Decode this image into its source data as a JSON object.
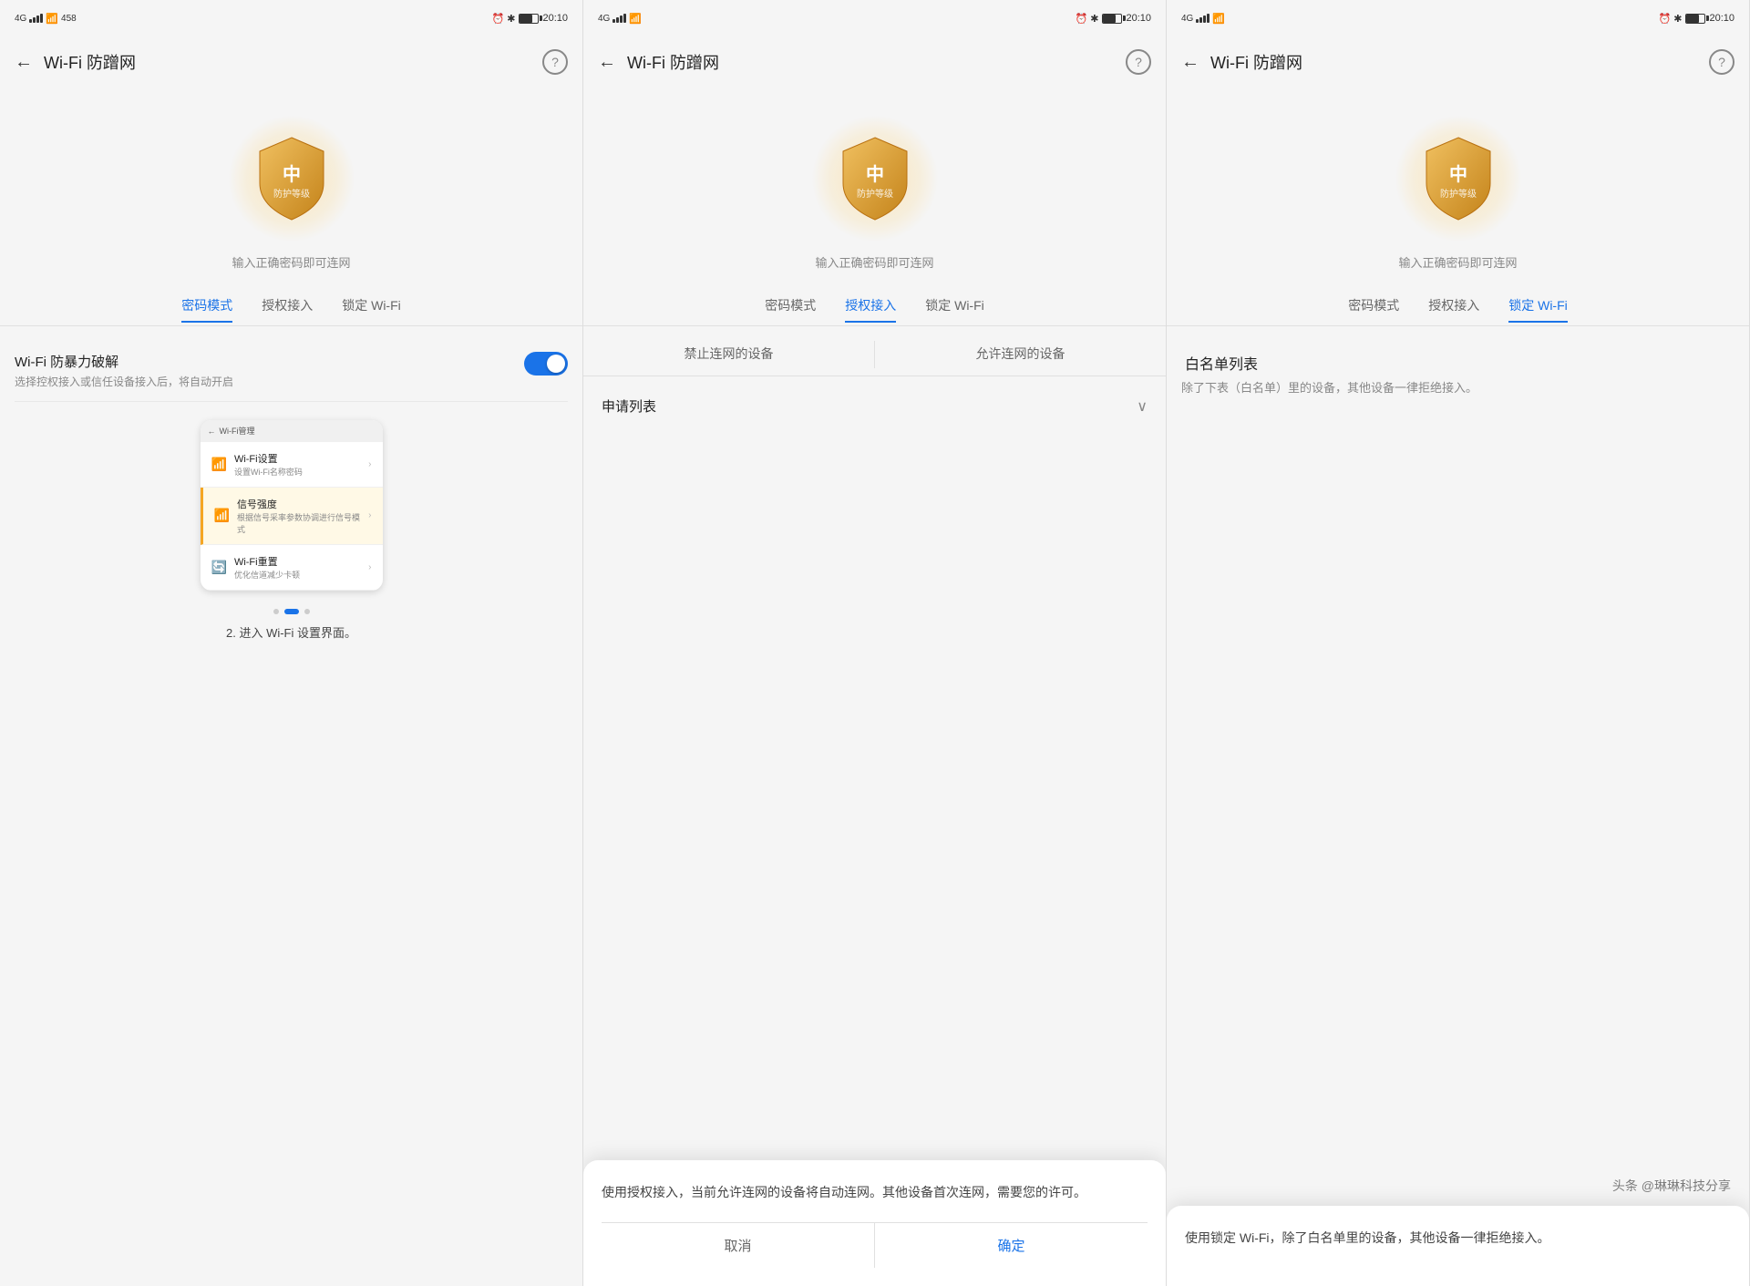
{
  "panels": [
    {
      "id": "panel1",
      "status_left": "4G ull ull",
      "status_right": "20:10",
      "title": "Wi-Fi 防蹭网",
      "shield_center": "中",
      "shield_sub": "防护等级",
      "shield_label": "输入正确密码即可连网",
      "tabs": [
        {
          "label": "密码模式",
          "active": false
        },
        {
          "label": "授权接入",
          "active": false
        },
        {
          "label": "锁定 Wi-Fi",
          "active": false
        }
      ],
      "active_tab": 0,
      "setting_title": "Wi-Fi 防暴力破解",
      "setting_desc": "选择控权接入或信任设备接入后，将自动开启",
      "toggle_on": true,
      "step_label": "2. 进入 Wi-Fi 设置界面。",
      "screenshot": {
        "header": "← Wi-Fi管理",
        "items": [
          {
            "icon": "wifi",
            "title": "Wi-Fi设置",
            "desc": "设置Wi-Fi名称密码",
            "highlighted": false
          },
          {
            "icon": "signal",
            "title": "信号强度",
            "desc": "根据信号采率参数协调进行信号模式",
            "highlighted": true
          },
          {
            "icon": "refresh",
            "title": "Wi-Fi重置",
            "desc": "优化信道减少卡顿",
            "highlighted": false
          }
        ]
      }
    },
    {
      "id": "panel2",
      "status_left": "4G ull ull",
      "status_right": "20:10",
      "title": "Wi-Fi 防蹭网",
      "shield_center": "中",
      "shield_sub": "防护等级",
      "shield_label": "输入正确密码即可连网",
      "tabs": [
        {
          "label": "密码模式",
          "active": false
        },
        {
          "label": "授权接入",
          "active": true
        },
        {
          "label": "锁定 Wi-Fi",
          "active": false
        }
      ],
      "active_tab": 1,
      "auth_tabs": [
        {
          "label": "禁止连网的设备",
          "active": false
        },
        {
          "label": "允许连网的设备",
          "active": false
        }
      ],
      "apply_label": "申请列表",
      "dialog_text": "使用授权接入，当前允许连网的设备将自动连网。其他设备首次连网，需要您的许可。",
      "dialog_cancel": "取消",
      "dialog_confirm": "确定"
    },
    {
      "id": "panel3",
      "status_left": "4G ull ull",
      "status_right": "20:10",
      "title": "Wi-Fi 防蹭网",
      "shield_center": "中",
      "shield_sub": "防护等级",
      "shield_label": "输入正确密码即可连网",
      "tabs": [
        {
          "label": "密码模式",
          "active": false
        },
        {
          "label": "授权接入",
          "active": false
        },
        {
          "label": "锁定 Wi-Fi",
          "active": true
        }
      ],
      "active_tab": 2,
      "whitelist_title": "白名单列表",
      "whitelist_desc": "除了下表（白名单）里的设备，其他设备一律拒绝接入。",
      "dialog_text": "使用锁定 Wi-Fi，除了白名单里的设备，其他设备一律拒绝接入。",
      "watermark": "头条 @琳琳科技分享"
    }
  ],
  "accent_color": "#1a73e8",
  "shield_gold": "#E8A020",
  "shield_dark_gold": "#C4831A"
}
